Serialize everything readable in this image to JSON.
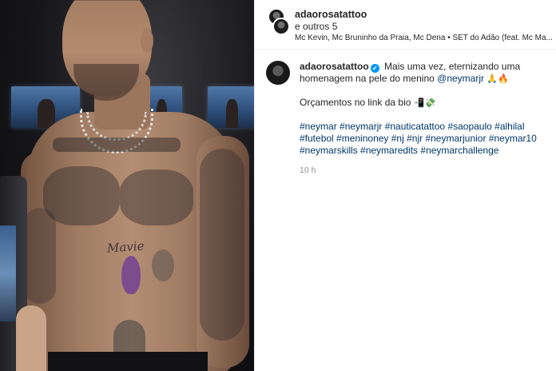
{
  "photo": {
    "tattoo_text": "Mavie"
  },
  "header": {
    "username": "adaorosatattoo",
    "collaborators": "e outros 5",
    "audio": "Mc Kevin, Mc Bruninho da Praia, Mc Dena • SET do Adão (feat. Mc Ma..."
  },
  "caption": {
    "username": "adaorosatattoo",
    "verified_mark": "✔",
    "text_before_mention": "Mais uma vez, eternizando uma homenagem na pele do menino",
    "mention": "@neymarjr",
    "emoji_after_mention": "🙏🔥",
    "budget_line": "Orçamentos no link da bio",
    "budget_emoji": "📲💸",
    "hashtags": "#neymar #neymarjr #nauticatattoo #saopaulo #alhilal #futebol #meninoney #nj #njr #neymarjunior #neymar10 #neymarskills #neymaredits #neymarchallenge",
    "time": "10 h"
  }
}
